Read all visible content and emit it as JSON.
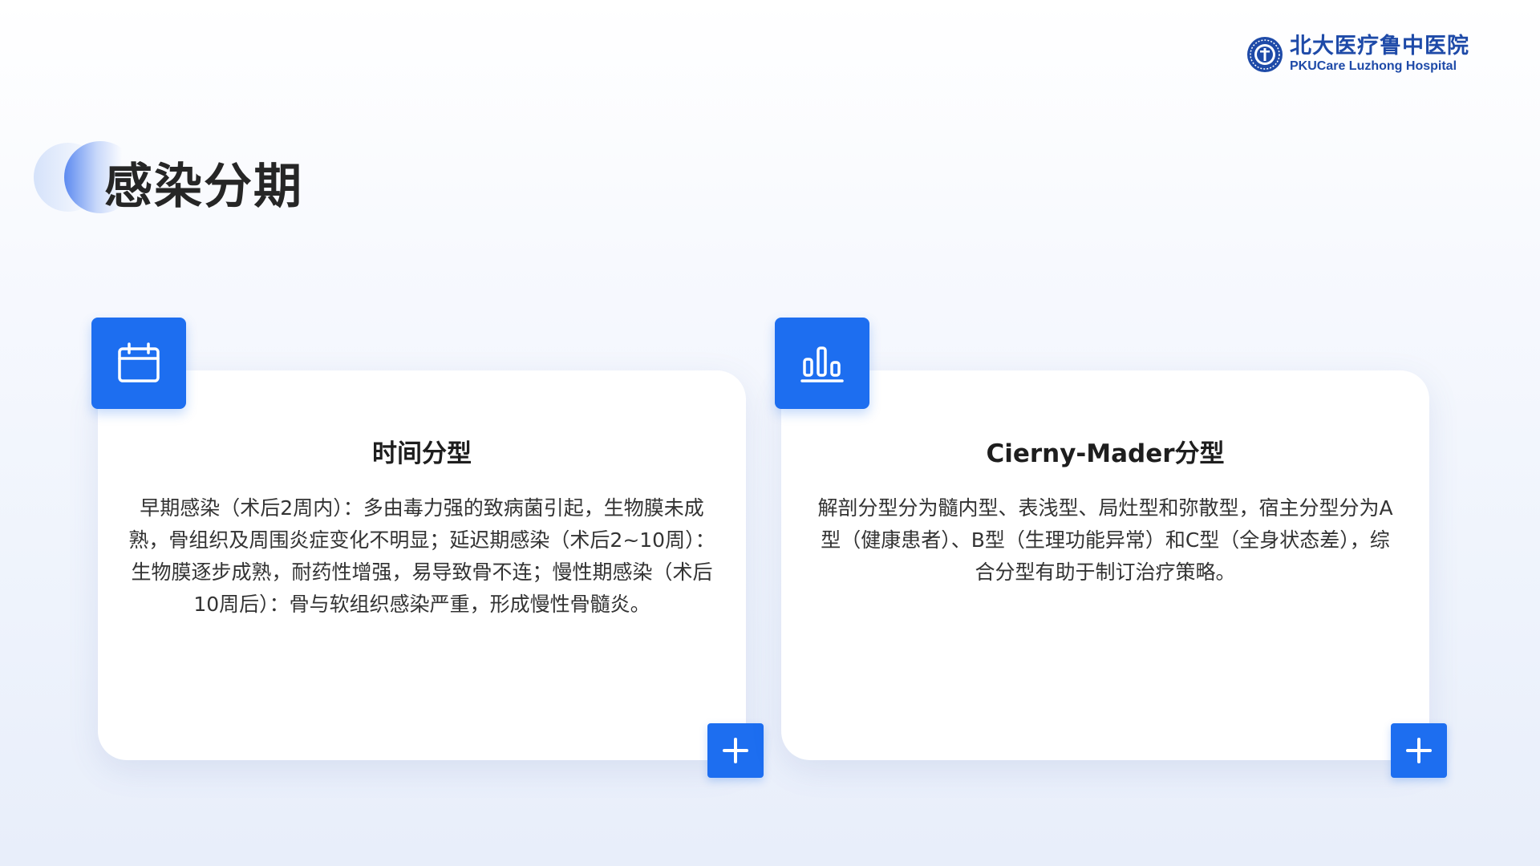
{
  "header": {
    "logo": {
      "name_cn": "北大医疗鲁中医院",
      "name_en": "PKUCare Luzhong Hospital"
    }
  },
  "title": "感染分期",
  "cards": [
    {
      "icon": "calendar-icon",
      "title": "时间分型",
      "body": "早期感染（术后2周内）：多由毒力强的致病菌引起，生物膜未成熟，骨组织及周围炎症变化不明显；延迟期感染（术后2~10周）：生物膜逐步成熟，耐药性增强，易导致骨不连；慢性期感染（术后10周后）：骨与软组织感染严重，形成慢性骨髓炎。",
      "action_icon": "plus-icon"
    },
    {
      "icon": "bar-chart-icon",
      "title": "Cierny-Mader分型",
      "body": "解剖分型分为髓内型、表浅型、局灶型和弥散型，宿主分型分为A型（健康患者）、B型（生理功能异常）和C型（全身状态差），综合分型有助于制订治疗策略。",
      "action_icon": "plus-icon"
    }
  ],
  "colors": {
    "accent": "#1d6ef0",
    "logo": "#1e4aa8",
    "title": "#262626",
    "body_text": "#333333"
  }
}
